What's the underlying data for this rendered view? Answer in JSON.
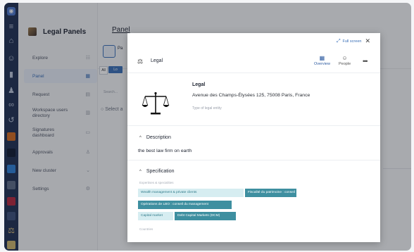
{
  "sidebar": {
    "title": "Legal Panels",
    "items": [
      {
        "label": "Explore",
        "icon": "users-icon"
      },
      {
        "label": "Panel",
        "icon": "grid-icon",
        "active": true
      },
      {
        "label": "Request",
        "icon": "document-icon"
      },
      {
        "label": "Workspace users directory",
        "icon": "list-icon"
      },
      {
        "label": "Signatures dashboard",
        "icon": "signature-icon"
      },
      {
        "label": "Approvals",
        "icon": "person-icon"
      },
      {
        "label": "New cluster",
        "icon": "chevron-down-icon"
      },
      {
        "label": "Settings",
        "icon": "gear-icon"
      }
    ]
  },
  "main": {
    "tab": "Panel",
    "panel_tag": "Pa",
    "all_label": "All",
    "lo_label": "Lo",
    "search_placeholder": "Search...",
    "select_all": "Select a"
  },
  "modal": {
    "fullscreen_label": "Full screen",
    "entity_title": "Legal",
    "tabs": {
      "overview": "Overview",
      "people": "People"
    },
    "card": {
      "name": "Legal",
      "address": "Avenue des Champs-Élysées 125, 75008 Paris, France",
      "type_label": "Type of legal entity"
    },
    "description": {
      "heading": "Description",
      "text": "the best law firm on earth"
    },
    "specification": {
      "heading": "Specification",
      "expertise_label": "Expertises & specialities",
      "tags": [
        {
          "label": "Wealth management & private clients",
          "style": "light"
        },
        {
          "label": "Fiscalité du patrimoine : conseil",
          "style": "dark"
        },
        {
          "label": "Opérations de LBO : conseil du management",
          "style": "dark"
        },
        {
          "label": "Capital market",
          "style": "light"
        },
        {
          "label": "Debt Capital Markets (DCM)",
          "style": "dark"
        }
      ],
      "countries_label": "Countries"
    }
  },
  "colors": {
    "rail": "#1e2f52",
    "accent": "#3a6fb7",
    "tag_dark": "#3e8fa0",
    "tag_light": "#d6edf1"
  }
}
